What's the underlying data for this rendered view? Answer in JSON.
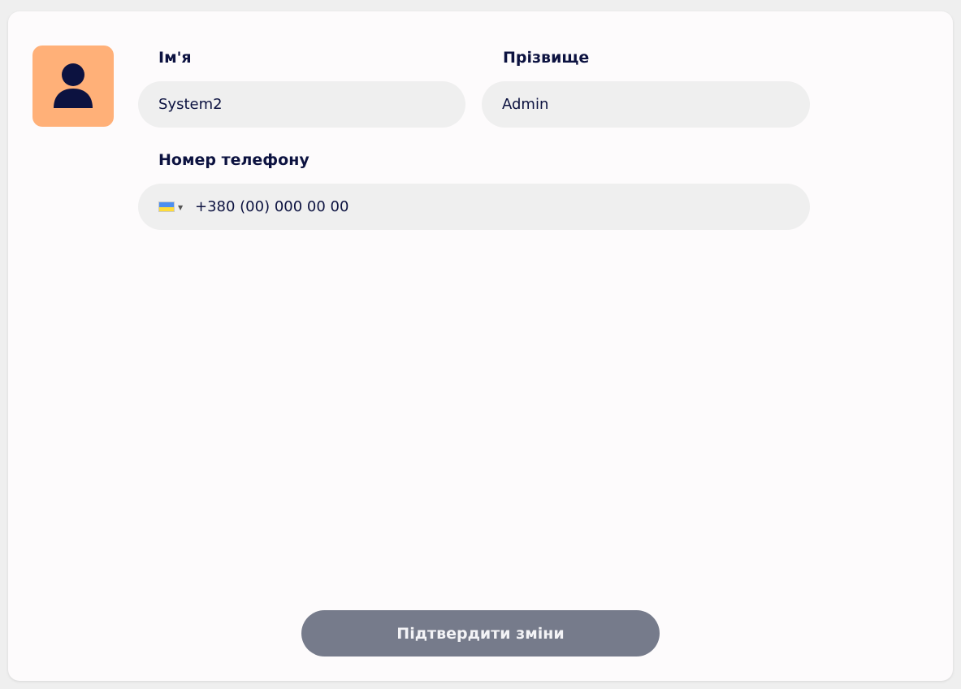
{
  "colors": {
    "page_background": "#efefef",
    "card_background": "#fdfbfc",
    "avatar_background": "#ffb078",
    "avatar_icon": "#0c1240",
    "field_background": "#efefef",
    "text": "#0c1240",
    "button_background": "#767b8b",
    "button_text": "#f3f3f6",
    "flag_blue": "#4d8ff0",
    "flag_yellow": "#ffdc3a"
  },
  "avatar": {
    "icon": "user-icon"
  },
  "form": {
    "first_name": {
      "label": "Ім'я",
      "value": "System2"
    },
    "last_name": {
      "label": "Прізвище",
      "value": "Admin"
    },
    "phone": {
      "label": "Номер телефону",
      "value": "+380 (00) 000 00 00",
      "country_flag": "ukraine-flag-icon",
      "dropdown_icon": "caret-down-icon"
    }
  },
  "submit": {
    "label": "Підтвердити зміни"
  }
}
